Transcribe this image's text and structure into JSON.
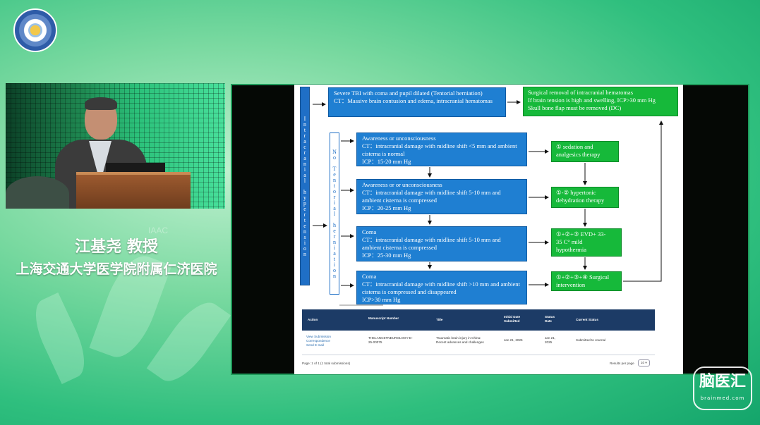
{
  "speaker": {
    "name": "江基尧 教授",
    "affiliation": "上海交通大学医学院附属仁济医院"
  },
  "background_text": "IAAC",
  "watermark": {
    "main": "脑医汇",
    "sub": "brainmed.com"
  },
  "slide": {
    "vertical_label_1": "Intracranial hypertension",
    "vertical_label_2": "No Tentorial herniation",
    "top_box": [
      "Severe TBI with coma and pupil dilated (Tentorial herniation)",
      "CT：Massive brain contusion and edema, intracranial hematomas"
    ],
    "top_green": [
      "Surgical removal of intracranial hematomas",
      "If brain tension is high and swelling, ICP>30 mm Hg",
      "Skull bone flap must be removed (DC)"
    ],
    "steps": [
      {
        "lines": [
          "Awareness or unconsciousness",
          "CT：intracranial damage with midline shift <5 mm and ambient cisterna is normal",
          "ICP：15-20 mm Hg"
        ],
        "treatment": [
          "① sedation and",
          "analgesics therapy"
        ]
      },
      {
        "lines": [
          "Awareness or or unconsciousness",
          "CT：intracranial damage with midline shift 5-10 mm and ambient cisterna is compressed",
          "ICP：20-25 mm Hg"
        ],
        "treatment": [
          "①-② hypertonic",
          "dehydration therapy"
        ]
      },
      {
        "lines": [
          "Coma",
          "CT：intracranial damage with midline shift 5-10 mm and ambient cisterna is compressed",
          "ICP：25-30 mm Hg"
        ],
        "treatment": [
          "①+②+③ EVD+ 33-",
          "35 C° mild",
          "hypothermia"
        ]
      },
      {
        "lines": [
          "Coma",
          "CT：intracranial damage with midline shift >10 mm and ambient cisterna is compressed and disappeared",
          "ICP>30 mm Hg"
        ],
        "treatment": [
          "①+②+③+④ Surgical",
          "intervention"
        ]
      }
    ]
  },
  "table": {
    "headers": {
      "action": "Action",
      "manuscript": "Manuscript Number",
      "title": "Title",
      "initial_date": "Initial Date Submitted",
      "status_date": "Status Date",
      "current_status": "Current Status"
    },
    "row": {
      "action": [
        "View Submission",
        "Correspondence",
        "Send E-mail"
      ],
      "manuscript": [
        "THELANCETNEUROLOGY-D-",
        "25-00075"
      ],
      "title": [
        "Traumatic brain injury in China:",
        "Recent advances and challenges"
      ],
      "initial_date": "Jan 21, 2025",
      "status_date": [
        "Jan 21,",
        "2025"
      ],
      "current_status": "Submitted to Journal"
    },
    "footer": {
      "page_info": "Page: 1 of 1 (1 total submissions)",
      "results_label": "Results per page",
      "results_value": "10"
    }
  }
}
